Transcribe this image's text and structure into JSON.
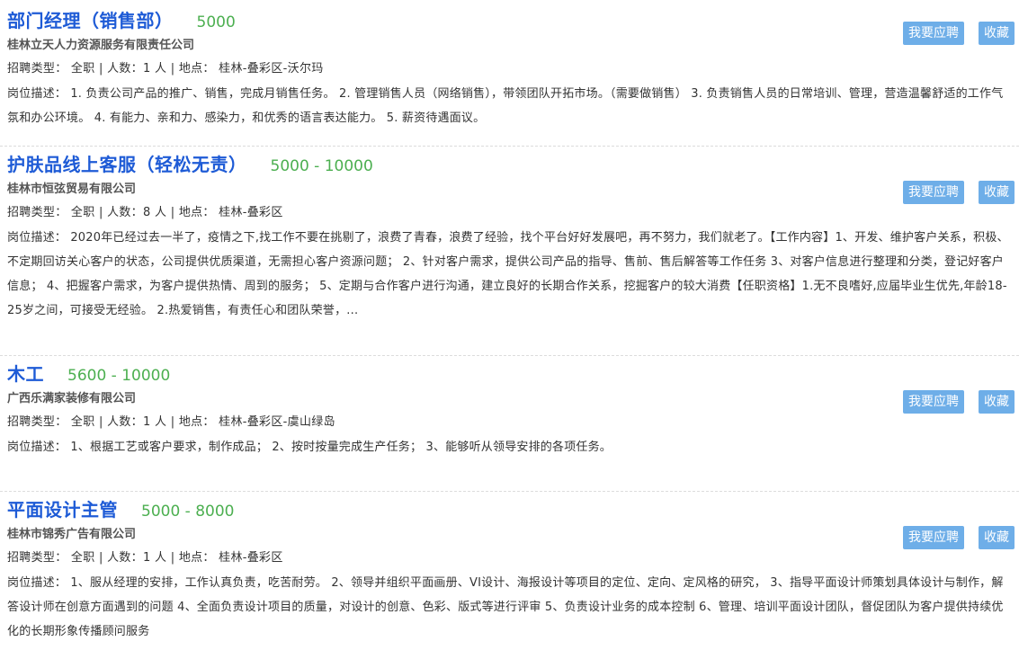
{
  "jobs": [
    {
      "title": "部门经理（销售部）",
      "salary": "5000",
      "company": "桂林立天人力资源服务有限责任公司",
      "meta": "招聘类型： 全职 | 人数：1 人 | 地点： 桂林-叠彩区-沃尔玛",
      "desc": "岗位描述： 1. 负责公司产品的推广、销售，完成月销售任务。 2. 管理销售人员（网络销售），带领团队开拓市场。（需要做销售） 3. 负责销售人员的日常培训、管理，营造温馨舒适的工作气氛和办公环境。 4. 有能力、亲和力、感染力，和优秀的语言表达能力。 5. 薪资待遇面议。",
      "apply_label": "我要应聘",
      "fav_label": "收藏"
    },
    {
      "title": "护肤品线上客服（轻松无责）",
      "salary": "5000 - 10000",
      "company": "桂林市恒弦贸易有限公司",
      "meta": "招聘类型： 全职 | 人数：8 人 | 地点： 桂林-叠彩区",
      "desc": "岗位描述： 2020年已经过去一半了，疫情之下,找工作不要在挑剔了，浪费了青春，浪费了经验，找个平台好好发展吧，再不努力，我们就老了。【工作内容】1、开发、维护客户关系，积极、不定期回访关心客户的状态，公司提供优质渠道，无需担心客户资源问题； 2、针对客户需求，提供公司产品的指导、售前、售后解答等工作任务 3、对客户信息进行整理和分类，登记好客户信息； 4、把握客户需求，为客户提供热情、周到的服务； 5、定期与合作客户进行沟通，建立良好的长期合作关系，挖掘客户的较大消费【任职资格】1.无不良嗜好,应届毕业生优先,年龄18-25岁之间，可接受无经验。 2.热爱销售，有责任心和团队荣誉，...",
      "apply_label": "我要应聘",
      "fav_label": "收藏"
    },
    {
      "title": "木工",
      "salary": "5600 - 10000",
      "company": "广西乐满家装修有限公司",
      "meta": "招聘类型： 全职 | 人数：1 人 | 地点： 桂林-叠彩区-虞山绿岛",
      "desc": "岗位描述： 1、根据工艺或客户要求，制作成品； 2、按时按量完成生产任务； 3、能够听从领导安排的各项任务。",
      "apply_label": "我要应聘",
      "fav_label": "收藏"
    },
    {
      "title": "平面设计主管",
      "salary": "5000 - 8000",
      "company": "桂林市锦秀广告有限公司",
      "meta": "招聘类型： 全职 | 人数：1 人 | 地点： 桂林-叠彩区",
      "desc": "岗位描述： 1、服从经理的安排，工作认真负责，吃苦耐劳。 2、领导并组织平面画册、VI设计、海报设计等项目的定位、定向、定风格的研究， 3、指导平面设计师策划具体设计与制作，解答设计师在创意方面遇到的问题 4、全面负责设计项目的质量，对设计的创意、色彩、版式等进行评审 5、负责设计业务的成本控制 6、管理、培训平面设计团队，督促团队为客户提供持续优化的长期形象传播顾问服务",
      "apply_label": "我要应聘",
      "fav_label": "收藏"
    }
  ]
}
